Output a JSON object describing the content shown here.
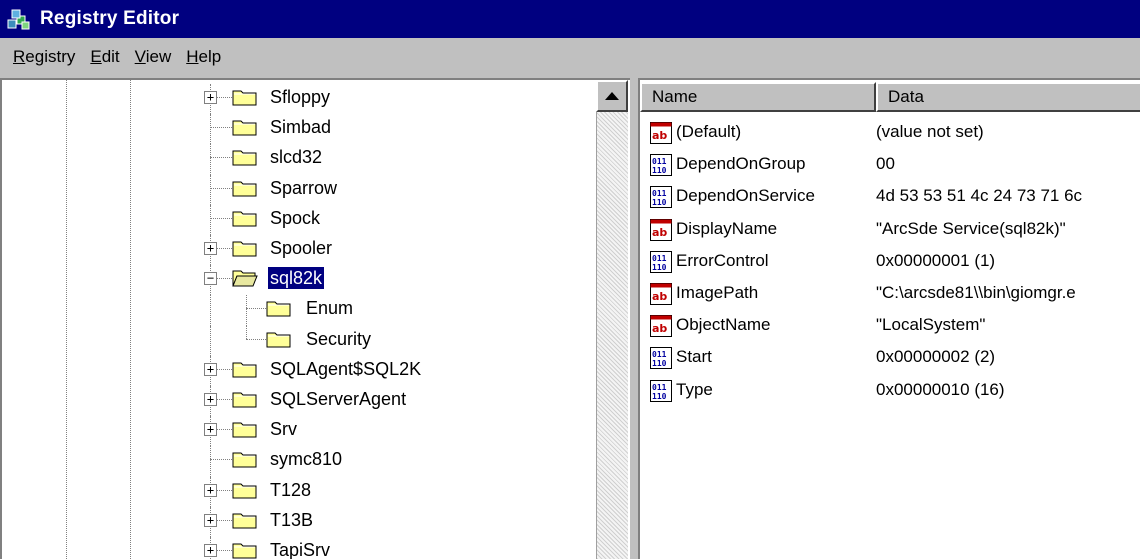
{
  "window": {
    "title": "Registry Editor"
  },
  "menu": [
    {
      "label_ul": "R",
      "label_rest": "egistry"
    },
    {
      "label_ul": "E",
      "label_rest": "dit"
    },
    {
      "label_ul": "V",
      "label_rest": "iew"
    },
    {
      "label_ul": "H",
      "label_rest": "elp"
    }
  ],
  "tree": {
    "items": [
      {
        "label": "Sfloppy",
        "expander": "+"
      },
      {
        "label": "Simbad",
        "expander": ""
      },
      {
        "label": "slcd32",
        "expander": ""
      },
      {
        "label": "Sparrow",
        "expander": ""
      },
      {
        "label": "Spock",
        "expander": ""
      },
      {
        "label": "Spooler",
        "expander": "+"
      },
      {
        "label": "sql82k",
        "expander": "−",
        "selected": true,
        "open": true
      },
      {
        "label": "Enum",
        "expander": "",
        "child": true
      },
      {
        "label": "Security",
        "expander": "",
        "child": true
      },
      {
        "label": "SQLAgent$SQL2K",
        "expander": "+"
      },
      {
        "label": "SQLServerAgent",
        "expander": "+"
      },
      {
        "label": "Srv",
        "expander": "+"
      },
      {
        "label": "symc810",
        "expander": ""
      },
      {
        "label": "T128",
        "expander": "+"
      },
      {
        "label": "T13B",
        "expander": "+"
      },
      {
        "label": "TapiSrv",
        "expander": "+"
      }
    ]
  },
  "list": {
    "columns": {
      "name": "Name",
      "data": "Data"
    },
    "rows": [
      {
        "type": "string",
        "name": "(Default)",
        "data": "(value not set)"
      },
      {
        "type": "binary",
        "name": "DependOnGroup",
        "data": "00"
      },
      {
        "type": "binary",
        "name": "DependOnService",
        "data": "4d 53 53 51 4c 24 73 71 6c"
      },
      {
        "type": "string",
        "name": "DisplayName",
        "data": "\"ArcSde Service(sql82k)\""
      },
      {
        "type": "binary",
        "name": "ErrorControl",
        "data": "0x00000001 (1)"
      },
      {
        "type": "string",
        "name": "ImagePath",
        "data": "\"C:\\arcsde81\\\\bin\\giomgr.e"
      },
      {
        "type": "string",
        "name": "ObjectName",
        "data": "\"LocalSystem\""
      },
      {
        "type": "binary",
        "name": "Start",
        "data": "0x00000002 (2)"
      },
      {
        "type": "binary",
        "name": "Type",
        "data": "0x00000010 (16)"
      }
    ]
  },
  "colors": {
    "titlebar": "#000080",
    "face": "#c0c0c0",
    "selection": "#000080",
    "folder": "#ffff99"
  }
}
